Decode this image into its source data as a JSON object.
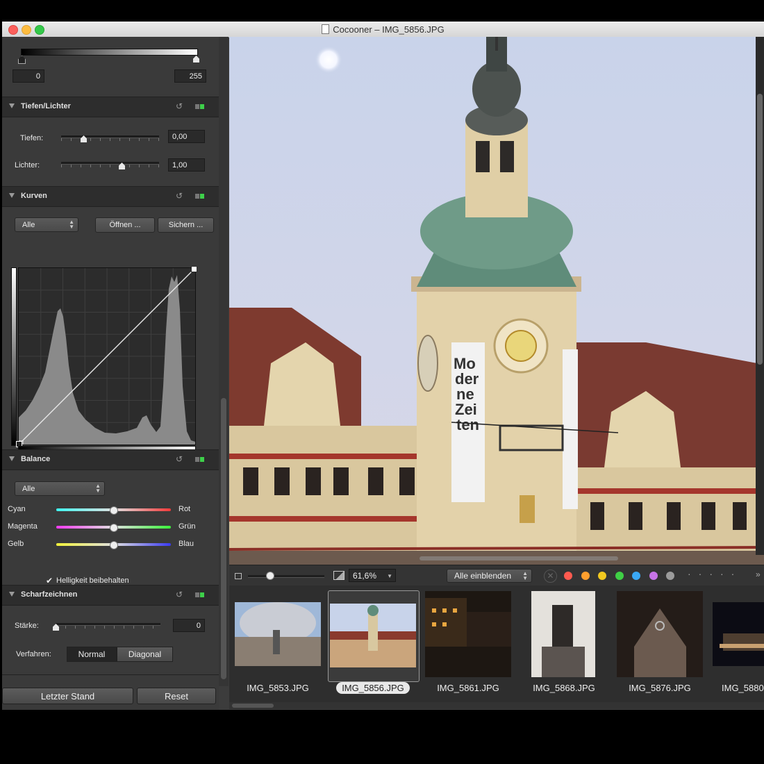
{
  "window": {
    "title": "Cocooner – IMG_5856.JPG"
  },
  "levels": {
    "min": "0",
    "max": "255"
  },
  "shadows_highlights": {
    "title": "Tiefen/Lichter",
    "shadows_label": "Tiefen:",
    "shadows_value": "0,00",
    "highlights_label": "Lichter:",
    "highlights_value": "1,00"
  },
  "curves": {
    "title": "Kurven",
    "channel": "Alle",
    "open_label": "Öffnen ...",
    "save_label": "Sichern ..."
  },
  "balance": {
    "title": "Balance",
    "channel": "Alle",
    "rows": [
      {
        "left": "Cyan",
        "right": "Rot",
        "value": 0.5
      },
      {
        "left": "Magenta",
        "right": "Grün",
        "value": 0.5
      },
      {
        "left": "Gelb",
        "right": "Blau",
        "value": 0.5
      }
    ],
    "preserve_label": "Helligkeit beibehalten"
  },
  "sharpen": {
    "title": "Scharfzeichnen",
    "strength_label": "Stärke:",
    "strength_value": "0",
    "method_label": "Verfahren:",
    "method_normal": "Normal",
    "method_diagonal": "Diagonal"
  },
  "footer": {
    "revert_label": "Letzter Stand",
    "reset_label": "Reset"
  },
  "viewer": {
    "zoom": "61,6%",
    "filter": "Alle einblenden",
    "label_colors": [
      "#ff5a4f",
      "#ff9f2e",
      "#f2c81f",
      "#3fcf45",
      "#3aa8f5",
      "#c774e8",
      "#9b9b9b"
    ]
  },
  "filmstrip": {
    "items": [
      {
        "name": "IMG_5853.JPG"
      },
      {
        "name": "IMG_5856.JPG"
      },
      {
        "name": "IMG_5861.JPG"
      },
      {
        "name": "IMG_5868.JPG"
      },
      {
        "name": "IMG_5876.JPG"
      },
      {
        "name": "IMG_5880"
      }
    ]
  }
}
